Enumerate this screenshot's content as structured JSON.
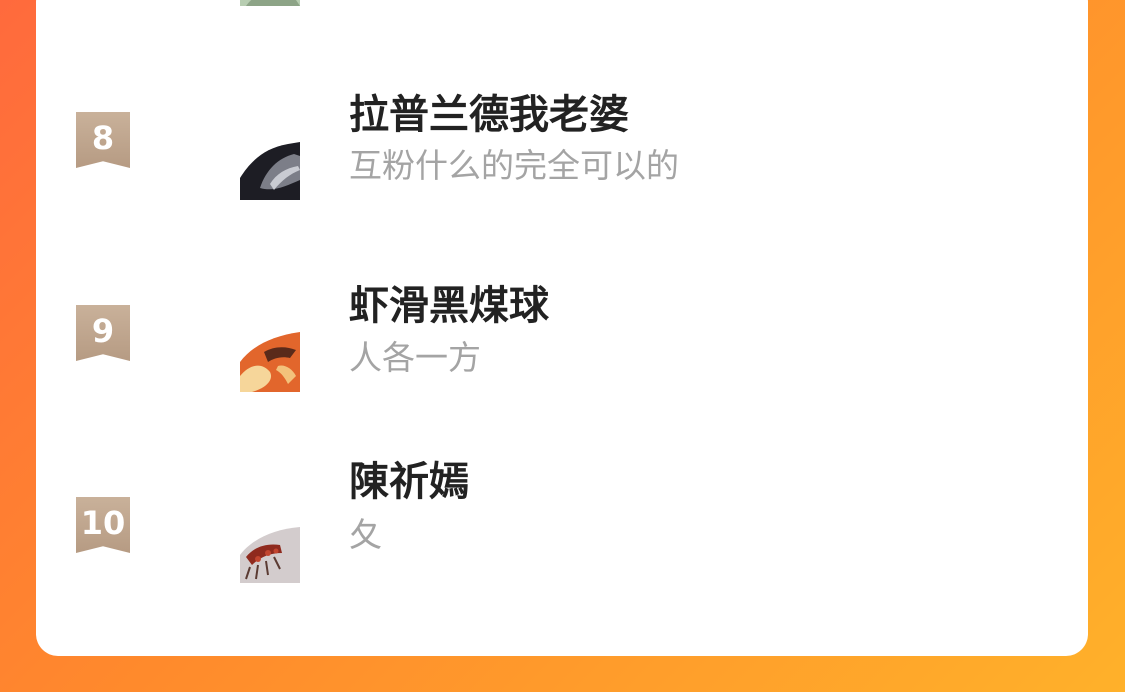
{
  "ranking": {
    "items": [
      {
        "rank": "8",
        "name": "拉普兰德我老婆",
        "signature": "互粉什么的完全可以的"
      },
      {
        "rank": "9",
        "name": "虾滑黑煤球",
        "signature": "人各一方"
      },
      {
        "rank": "10",
        "name": "陳祈嫣",
        "signature": "夂"
      }
    ]
  },
  "colors": {
    "background_start": "#ff6a3d",
    "background_end": "#ffb12a",
    "rank_badge": "#c0a68e",
    "name_text": "#222222",
    "signature_text": "#a4a4a4"
  }
}
